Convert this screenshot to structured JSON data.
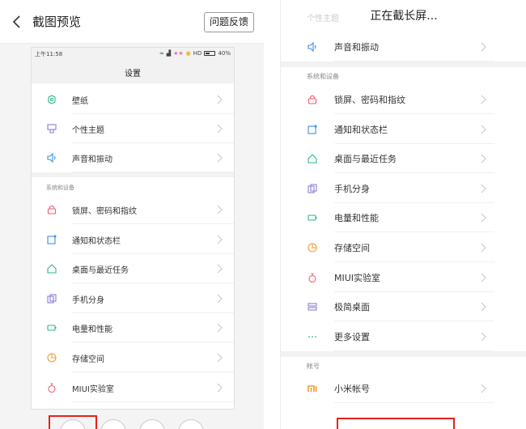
{
  "left": {
    "title": "截图预览",
    "feedback_label": "问题反馈",
    "phone": {
      "status_time": "上午11:58",
      "status_hd": "HD",
      "status_battery": "40%",
      "title": "设置",
      "section_label": "系统和设备",
      "items_top": [
        {
          "label": "壁纸",
          "icon": "wallpaper-icon",
          "color": "#2fb68a"
        },
        {
          "label": "个性主题",
          "icon": "theme-icon",
          "color": "#8a7fd6"
        },
        {
          "label": "声音和振动",
          "icon": "speaker-icon",
          "color": "#3a8fe0"
        }
      ],
      "items_system": [
        {
          "label": "锁屏、密码和指纹",
          "icon": "lock-icon",
          "color": "#ef5a6e"
        },
        {
          "label": "通知和状态栏",
          "icon": "notification-icon",
          "color": "#3a8fe0"
        },
        {
          "label": "桌面与最近任务",
          "icon": "home-icon",
          "color": "#2fb68a"
        },
        {
          "label": "手机分身",
          "icon": "dual-phone-icon",
          "color": "#8a7fd6"
        },
        {
          "label": "电量和性能",
          "icon": "battery-icon",
          "color": "#2fb68a"
        },
        {
          "label": "存储空间",
          "icon": "storage-icon",
          "color": "#f39a33"
        },
        {
          "label": "MIUI实验室",
          "icon": "flask-icon",
          "color": "#ef5a6e"
        }
      ]
    }
  },
  "right": {
    "title": "正在截长屏...",
    "faded_text": "个性主题",
    "section_system": "系统和设备",
    "section_account": "帐号",
    "items_top": [
      {
        "label": "声音和振动",
        "icon": "speaker-icon",
        "color": "#3a8fe0"
      }
    ],
    "items_system": [
      {
        "label": "锁屏、密码和指纹",
        "icon": "lock-icon",
        "color": "#ef5a6e"
      },
      {
        "label": "通知和状态栏",
        "icon": "notification-icon",
        "color": "#3a8fe0"
      },
      {
        "label": "桌面与最近任务",
        "icon": "home-icon",
        "color": "#2fb68a"
      },
      {
        "label": "手机分身",
        "icon": "dual-phone-icon",
        "color": "#8a7fd6"
      },
      {
        "label": "电量和性能",
        "icon": "battery-icon",
        "color": "#2fb68a"
      },
      {
        "label": "存储空间",
        "icon": "storage-icon",
        "color": "#f39a33"
      },
      {
        "label": "MIUI实验室",
        "icon": "flask-icon",
        "color": "#ef5a6e"
      },
      {
        "label": "极简桌面",
        "icon": "simple-home-icon",
        "color": "#8a7fd6"
      },
      {
        "label": "更多设置",
        "icon": "more-icon",
        "color": "#2fb68a"
      }
    ],
    "items_account": [
      {
        "label": "小米帐号",
        "icon": "mi-icon",
        "color": "#f39a33"
      }
    ]
  },
  "colors": {
    "highlight": "#e8201a",
    "chevron": "#c8c8c8"
  }
}
